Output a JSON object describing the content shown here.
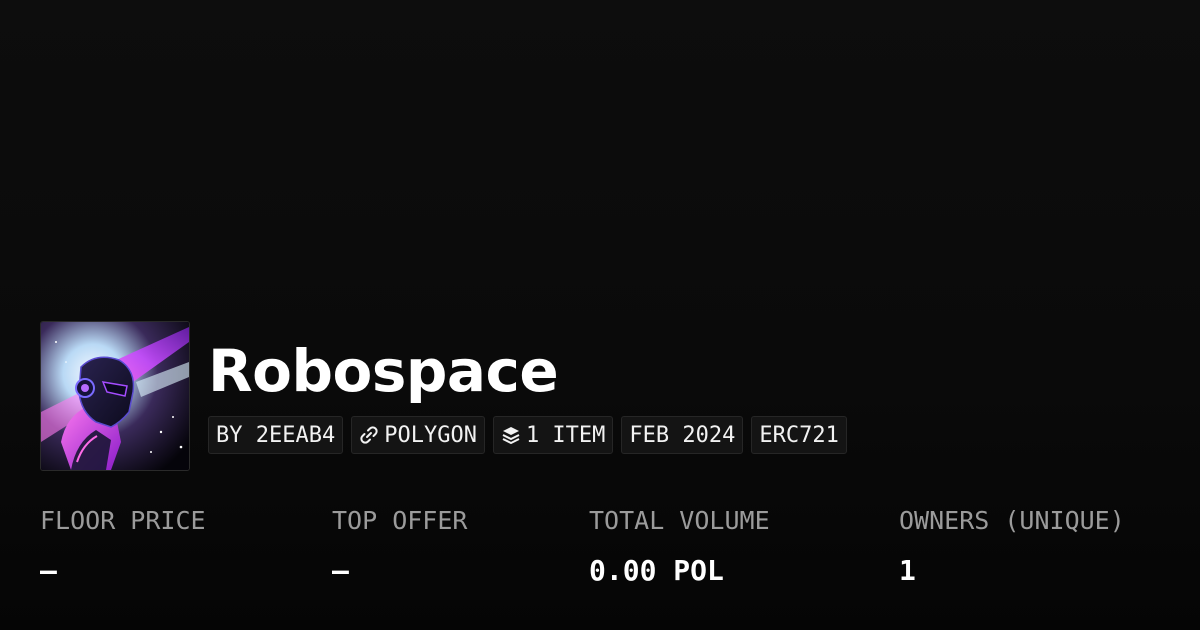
{
  "collection": {
    "name": "Robospace",
    "avatar_icon": "robot-avatar-image"
  },
  "tags": {
    "creator": "BY 2EEAB4",
    "chain": "POLYGON",
    "chain_icon": "link-icon",
    "items": "1 ITEM",
    "items_icon": "layers-icon",
    "date": "FEB 2024",
    "standard": "ERC721"
  },
  "stats": {
    "floor_price": {
      "label": "FLOOR PRICE",
      "value": "—"
    },
    "top_offer": {
      "label": "TOP OFFER",
      "value": "—"
    },
    "total_volume": {
      "label": "TOTAL VOLUME",
      "value": "0.00 POL"
    },
    "owners": {
      "label": "OWNERS (UNIQUE)",
      "value": "1"
    }
  },
  "colors": {
    "background": "#0b0b0b",
    "label_gray": "#9b9b9b",
    "accent_purple": "#a020f0"
  }
}
